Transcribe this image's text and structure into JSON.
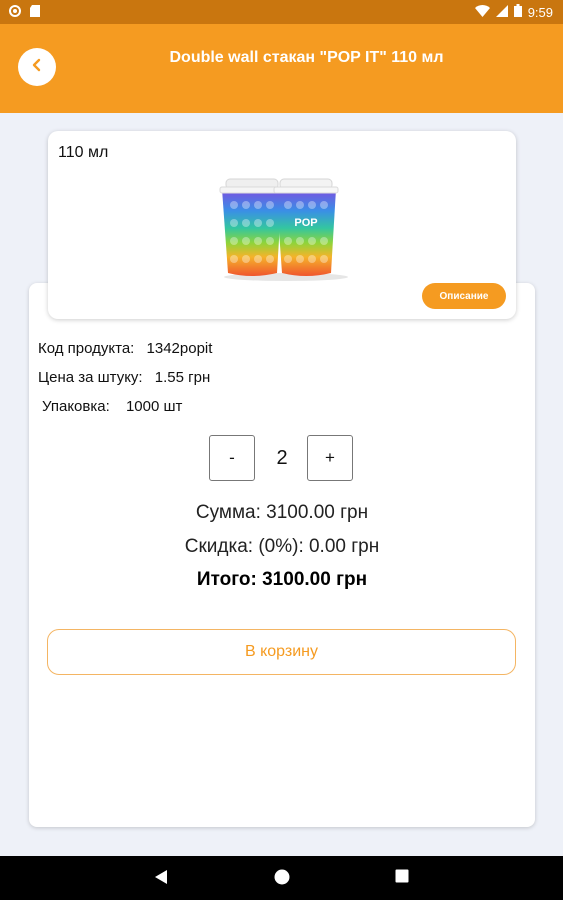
{
  "status_bar": {
    "time": "9:59"
  },
  "header": {
    "title": "Double wall стакан \"POP IT\" 110 мл"
  },
  "product": {
    "variant": "110 мл",
    "image_label": "POP",
    "description_button": "Описание",
    "code_label": "Код продукта:",
    "code_value": "1342popit",
    "price_label": "Цена за штуку:",
    "price_value": "1.55 грн",
    "pack_label": "Упаковка:",
    "pack_value": "1000 шт"
  },
  "quantity": {
    "minus": "-",
    "value": "2",
    "plus": "+"
  },
  "totals": {
    "sum": "Сумма: 3100.00 грн",
    "discount": "Скидка: (0%): 0.00 грн",
    "total": "Итого: 3100.00 грн"
  },
  "cart_button": "В корзину",
  "colors": {
    "accent": "#f59b21",
    "status_bar": "#c9760f",
    "background": "#eef1f8"
  }
}
